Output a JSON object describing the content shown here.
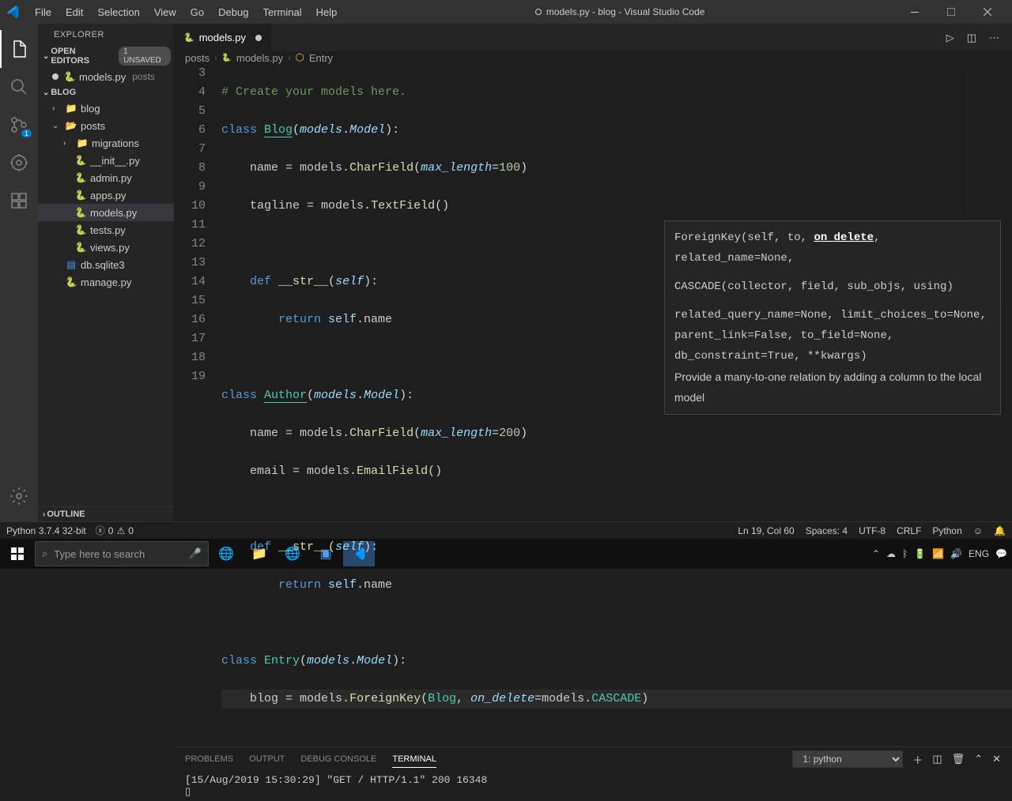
{
  "window": {
    "title": "models.py - blog - Visual Studio Code"
  },
  "menu": [
    "File",
    "Edit",
    "Selection",
    "View",
    "Go",
    "Debug",
    "Terminal",
    "Help"
  ],
  "activity": {
    "badge_scm": "1"
  },
  "explorer": {
    "header": "EXPLORER",
    "open_editors": "OPEN EDITORS",
    "unsaved": "1 UNSAVED",
    "open_file": "models.py",
    "open_file_dir": "posts",
    "workspace": "BLOG",
    "tree": {
      "folder_blog": "blog",
      "folder_posts": "posts",
      "folder_migrations": "migrations",
      "file_init": "__init__.py",
      "file_admin": "admin.py",
      "file_apps": "apps.py",
      "file_models": "models.py",
      "file_tests": "tests.py",
      "file_views": "views.py",
      "file_db": "db.sqlite3",
      "file_manage": "manage.py"
    },
    "outline": "OUTLINE"
  },
  "tab": {
    "name": "models.py"
  },
  "breadcrumb": {
    "b1": "posts",
    "b2": "models.py",
    "b3": "Entry"
  },
  "gutter": [
    "3",
    "4",
    "5",
    "6",
    "7",
    "8",
    "9",
    "10",
    "11",
    "12",
    "13",
    "14",
    "15",
    "16",
    "17",
    "18",
    "19"
  ],
  "code": {
    "l3_comment": "# Create your models here.",
    "l4_class": "class ",
    "l4_blog": "Blog",
    "l4_models": "models",
    "l4_model": "Model",
    "l5_name": "name = ",
    "l5_models": "models",
    "l5_cf": "CharField",
    "l5_ml": "max_length",
    "l5_val": "100",
    "l6_tagline": "tagline = ",
    "l6_models": "models",
    "l6_tf": "TextField",
    "l8_def": "def ",
    "l8_str": "__str__",
    "l8_self": "self",
    "l9_return": "return ",
    "l9_self": "self",
    "l9_name": ".name",
    "l11_class": "class ",
    "l11_author": "Author",
    "l11_models": "models",
    "l11_model": "Model",
    "l12_name": "name = ",
    "l12_models": "models",
    "l12_cf": "CharField",
    "l12_ml": "max_length",
    "l12_val": "200",
    "l13_email": "email = ",
    "l13_models": "models",
    "l13_ef": "EmailField",
    "l15_def": "def ",
    "l15_str": "__str__",
    "l15_self": "self",
    "l16_return": "return ",
    "l16_self": "self",
    "l16_name": ".name",
    "l18_class": "class ",
    "l18_entry": "Entry",
    "l18_models": "models",
    "l18_model": "Model",
    "l19_blog": "blog = ",
    "l19_models": "models",
    "l19_fk": "ForeignKey",
    "l19_blogcls": "Blog",
    "l19_od": "on_delete",
    "l19_models2": "models",
    "l19_cascade": "CASCADE"
  },
  "hover": {
    "sig1a": "ForeignKey(self, to, ",
    "sig1b": "on_delete",
    "sig1c": ",",
    "sig2": "related_name=None,",
    "sig3": "CASCADE(collector, field, sub_objs, using)",
    "sig4": "related_query_name=None, limit_choices_to=None, parent_link=False, to_field=None, db_constraint=True, **kwargs)",
    "doc": "Provide a many-to-one relation by adding a column to the local model"
  },
  "panel": {
    "tabs": [
      "PROBLEMS",
      "OUTPUT",
      "DEBUG CONSOLE",
      "TERMINAL"
    ],
    "select": "1: python",
    "terminal_line": "[15/Aug/2019 15:30:29] \"GET / HTTP/1.1\" 200 16348"
  },
  "status": {
    "python": "Python 3.7.4 32-bit",
    "errors": "0",
    "warnings": "0",
    "lncol": "Ln 19, Col 60",
    "spaces": "Spaces: 4",
    "enc": "UTF-8",
    "eol": "CRLF",
    "lang": "Python"
  },
  "taskbar": {
    "search_placeholder": "Type here to search",
    "lang": "ENG",
    "time": "",
    "date": ""
  }
}
